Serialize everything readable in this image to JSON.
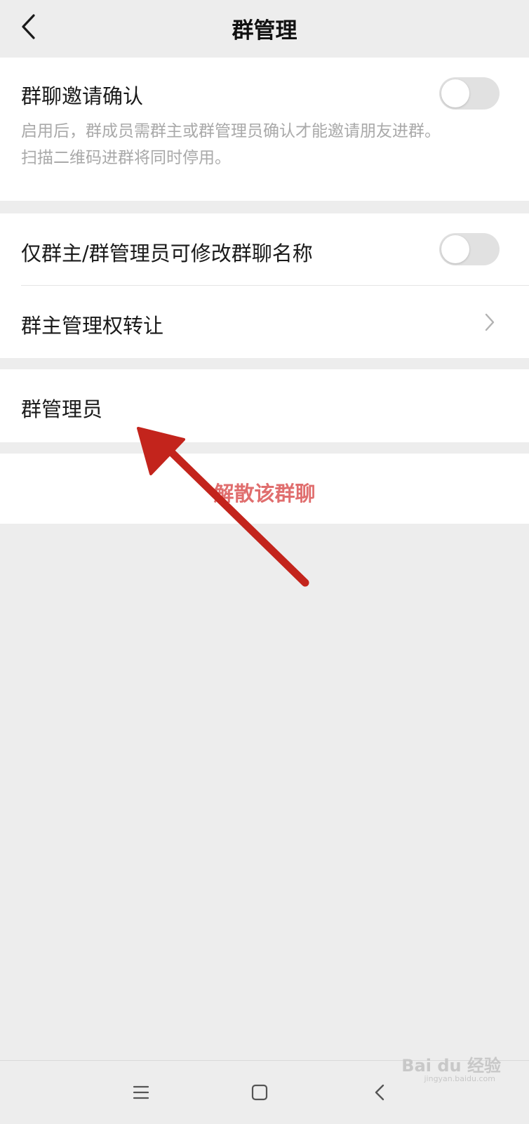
{
  "header": {
    "title": "群管理"
  },
  "sections": {
    "invite_confirm": {
      "label": "群聊邀请确认",
      "description_line1": "启用后，群成员需群主或群管理员确认才能邀请朋友进群。",
      "description_line2": "扫描二维码进群将同时停用。",
      "enabled": false
    },
    "rename_restrict": {
      "label": "仅群主/群管理员可修改群聊名称",
      "enabled": false
    },
    "transfer_owner": {
      "label": "群主管理权转让"
    },
    "admins": {
      "label": "群管理员"
    },
    "dissolve": {
      "label": "解散该群聊"
    }
  },
  "navbar": {
    "icons": [
      "menu-icon",
      "home-square-icon",
      "back-chevron-icon"
    ]
  },
  "watermark": {
    "text": "Bai du 经验",
    "sub": "jingyan.baidu.com"
  },
  "colors": {
    "background": "#ededed",
    "danger_text": "#e06e6e",
    "annotation_arrow": "#c3241c",
    "toggle_off": "#e1e1e1"
  }
}
